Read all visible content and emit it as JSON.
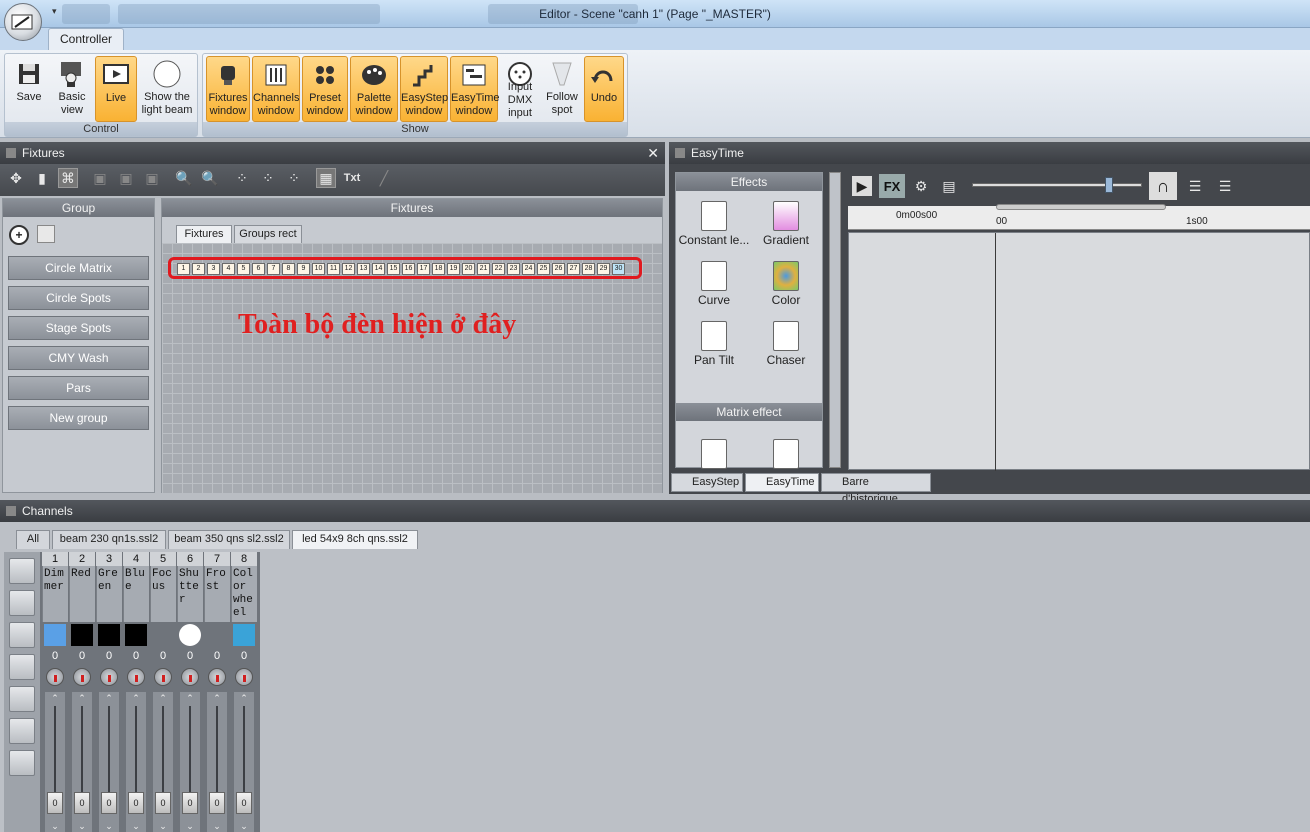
{
  "window": {
    "title": "Editor - Scene \"canh 1\" (Page \"_MASTER\")"
  },
  "ribbon": {
    "tab": "Controller",
    "groups": [
      {
        "label": "Control",
        "buttons": [
          {
            "label": "Save",
            "icon": "floppy-icon",
            "active": false
          },
          {
            "label": "Basic view",
            "icon": "basic-view-icon",
            "active": false
          },
          {
            "label": "Live",
            "icon": "live-monitor-icon",
            "active": true
          },
          {
            "label": "Show the light beam",
            "icon": "light-beam-circle-icon",
            "active": false
          }
        ]
      },
      {
        "label": "Show",
        "buttons": [
          {
            "label": "Fixtures window",
            "icon": "fixture-icon",
            "active": true
          },
          {
            "label": "Channels window",
            "icon": "sliders-icon",
            "active": true
          },
          {
            "label": "Preset window",
            "icon": "preset-dots-icon",
            "active": true
          },
          {
            "label": "Palette window",
            "icon": "palette-icon",
            "active": true
          },
          {
            "label": "EasyStep window",
            "icon": "easystep-icon",
            "active": true
          },
          {
            "label": "EasyTime window",
            "icon": "easytime-icon",
            "active": true
          },
          {
            "label": "Input DMX input",
            "icon": "dmx-connector-icon",
            "active": false
          },
          {
            "label": "Follow spot",
            "icon": "follow-spot-icon",
            "active": false
          },
          {
            "label": "Undo",
            "icon": "undo-icon",
            "active": true
          }
        ]
      }
    ]
  },
  "fixtures_panel": {
    "title": "Fixtures",
    "group_header": "Group",
    "groups": [
      "Circle Matrix",
      "Circle Spots",
      "Stage Spots",
      "CMY Wash",
      "Pars",
      "New group"
    ],
    "area_header": "Fixtures",
    "tabs": [
      "Fixtures",
      "Groups rect"
    ],
    "annotation": "Toàn bộ đèn hiện ở đây",
    "fixture_count": 30
  },
  "easytime": {
    "title": "EasyTime",
    "effects_header": "Effects",
    "effects": [
      "Constant le...",
      "Gradient",
      "Curve",
      "Color",
      "Pan Tilt",
      "Chaser"
    ],
    "matrix_header": "Matrix effect",
    "ruler": {
      "start": "0m00s00",
      "mark0": "00",
      "mark1": "1s00"
    },
    "bottom_tabs": [
      "EasyStep",
      "EasyTime",
      "Barre d'historique"
    ],
    "toolbar_fx": "FX"
  },
  "channels": {
    "title": "Channels",
    "tabs": [
      "All",
      "beam 230 qn1s.ssl2",
      "beam 350 qns sl2.ssl2",
      "led 54x9 8ch qns.ssl2"
    ],
    "active_tab": 3,
    "columns": [
      {
        "num": "1",
        "name": "Dimmer",
        "value": "0",
        "swatch": "#5aa0e6"
      },
      {
        "num": "2",
        "name": "Red",
        "value": "0",
        "swatch": "#000000"
      },
      {
        "num": "3",
        "name": "Green",
        "value": "0",
        "swatch": "#000000"
      },
      {
        "num": "4",
        "name": "Blue",
        "value": "0",
        "swatch": "#000000"
      },
      {
        "num": "5",
        "name": "Focus",
        "value": "0",
        "swatch": ""
      },
      {
        "num": "6",
        "name": "Shutter",
        "value": "0",
        "swatch": "#ffffff"
      },
      {
        "num": "7",
        "name": "Frost",
        "value": "0",
        "swatch": ""
      },
      {
        "num": "8",
        "name": "Color wheel",
        "value": "0",
        "swatch": "#3aa3d8"
      }
    ],
    "fader_value": "0"
  },
  "colors": {
    "accent": "#f9b233",
    "annotation": "#e02020",
    "panel_header": "#3a3d42"
  }
}
